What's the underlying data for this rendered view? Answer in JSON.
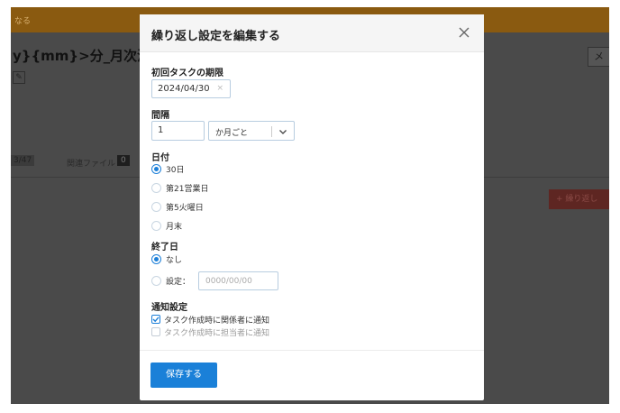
{
  "background": {
    "banner_text": "なる",
    "title": "y}{mm}>分_月次決算",
    "right_button": "メ",
    "tab_count": "3/47",
    "tab_label": "関連ファイル",
    "tab_badge": "0",
    "red_button": "+ 繰り返し"
  },
  "modal": {
    "title": "繰り返し設定を編集する",
    "close_icon": "close-icon",
    "first_due": {
      "label": "初回タスクの期限",
      "value": "2024/04/30",
      "clear": "×"
    },
    "interval": {
      "label": "間隔",
      "value": "1",
      "unit": "か月ごと"
    },
    "day": {
      "label": "日付",
      "options": [
        {
          "label": "30日",
          "checked": true
        },
        {
          "label": "第21営業日",
          "checked": false
        },
        {
          "label": "第5火曜日",
          "checked": false
        },
        {
          "label": "月末",
          "checked": false
        }
      ]
    },
    "end": {
      "label": "終了日",
      "options": [
        {
          "label": "なし",
          "checked": true
        },
        {
          "label": "設定：",
          "checked": false
        }
      ],
      "placeholder": "0000/00/00"
    },
    "notify": {
      "label": "通知設定",
      "options": [
        {
          "label": "タスク作成時に関係者に通知",
          "checked": true
        },
        {
          "label": "タスク作成時に担当者に通知",
          "checked": false
        }
      ]
    },
    "save_label": "保存する"
  },
  "colors": {
    "accent": "#1a80d8",
    "overlay": "#4a4a4a"
  }
}
